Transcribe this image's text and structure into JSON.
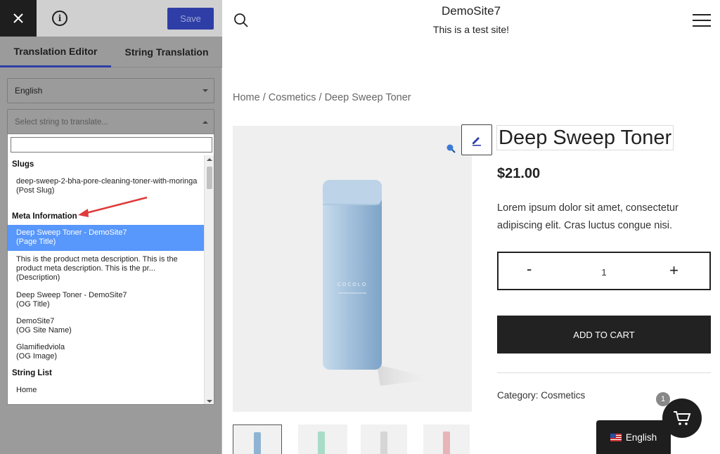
{
  "editor": {
    "save_label": "Save",
    "tabs": [
      "Translation Editor",
      "String Translation"
    ],
    "language_value": "English",
    "string_select_placeholder": "Select string to translate...",
    "search_value": "",
    "groups": [
      "Slugs",
      "Meta Information",
      "String List"
    ],
    "options": [
      {
        "label": "deep-sweep-2-bha-pore-cleaning-toner-with-moringa",
        "type": "(Post Slug)",
        "selected": false
      },
      {
        "label": "Deep Sweep Toner - DemoSite7",
        "type": "(Page Title)",
        "selected": true
      },
      {
        "label": "This is the product meta description. This is the product meta description. This is the pr...",
        "type": "(Description)",
        "selected": false
      },
      {
        "label": "Deep Sweep Toner - DemoSite7",
        "type": "(OG Title)",
        "selected": false
      },
      {
        "label": "DemoSite7",
        "type": "(OG Site Name)",
        "selected": false
      },
      {
        "label": "Glamifiedviola",
        "type": "(OG Image)",
        "selected": false
      },
      {
        "label": "Home",
        "type": "",
        "selected": false
      }
    ],
    "accent_color": "#2f3ea6",
    "highlight_color": "#5897fb"
  },
  "site": {
    "title": "DemoSite7",
    "tagline": "This is a test site!"
  },
  "breadcrumb": {
    "home": "Home",
    "sep": " / ",
    "category": "Cosmetics",
    "current": "Deep Sweep Toner"
  },
  "product": {
    "title": "Deep Sweep Toner",
    "price": "$21.00",
    "description": "Lorem ipsum dolor sit amet, consectetur adipiscing elit. Cras luctus congue nisi.",
    "qty_minus": "-",
    "quantity": "1",
    "qty_plus": "+",
    "add_to_cart": "ADD TO CART",
    "category_label": "Category: ",
    "category_value": "Cosmetics",
    "bottle_brand": "COCOLO",
    "bottle_color": "#a9c4dc"
  },
  "cart": {
    "count": "1"
  },
  "language_switcher": {
    "label": "English"
  },
  "thumbnails": [
    {
      "color": "#8fb3d3",
      "active": true
    },
    {
      "color": "#a8dcc6",
      "active": false
    },
    {
      "color": "#d6d6d6",
      "active": false
    },
    {
      "color": "#e8b4b8",
      "active": false
    }
  ]
}
